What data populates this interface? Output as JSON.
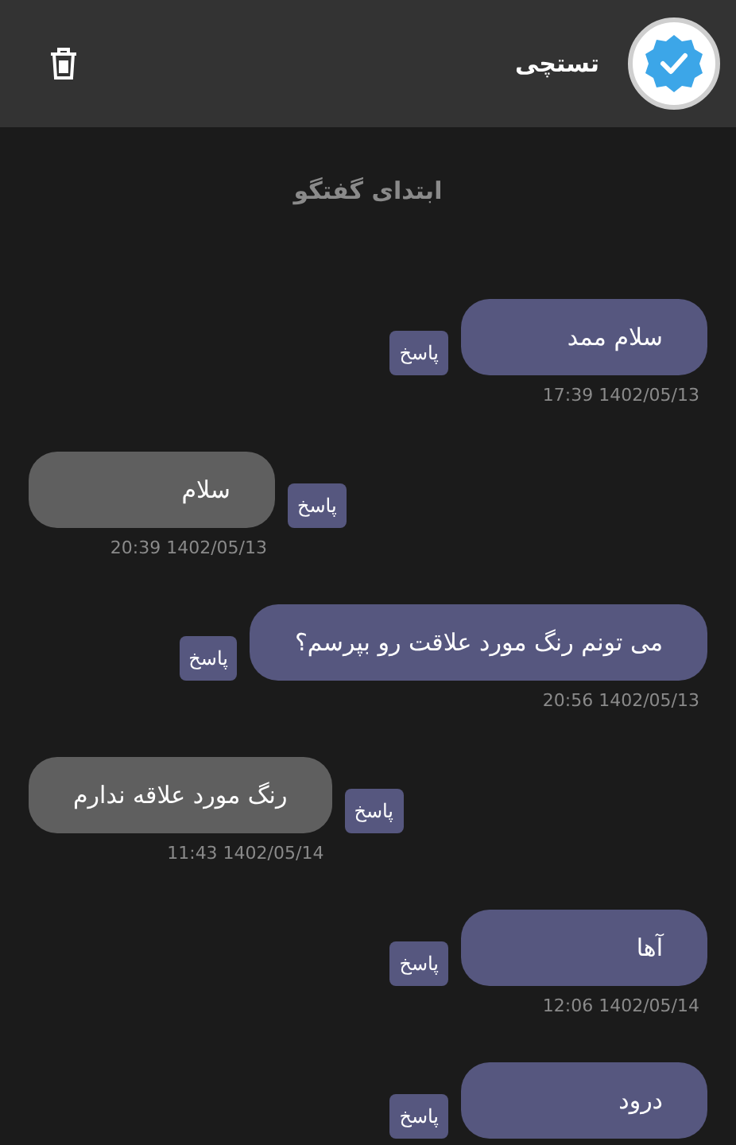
{
  "header": {
    "title": "تستچی"
  },
  "conversation_start": "ابتدای گفتگو",
  "messages": [
    {
      "kind": "sent",
      "text": "سلام ممد",
      "reply_label": "پاسخ",
      "time": "17:39 1402/05/13"
    },
    {
      "kind": "received",
      "text": "سلام",
      "reply_label": "پاسخ",
      "time": "20:39 1402/05/13"
    },
    {
      "kind": "sent",
      "text": "می تونم رنگ مورد علاقت رو بپرسم؟",
      "reply_label": "پاسخ",
      "time": "20:56 1402/05/13"
    },
    {
      "kind": "received",
      "text": "رنگ مورد علاقه ندارم",
      "reply_label": "پاسخ",
      "time": "11:43 1402/05/14"
    },
    {
      "kind": "sent",
      "text": "آها",
      "reply_label": "پاسخ",
      "time": "12:06 1402/05/14"
    },
    {
      "kind": "sent",
      "text": "درود",
      "reply_label": "پاسخ"
    }
  ]
}
